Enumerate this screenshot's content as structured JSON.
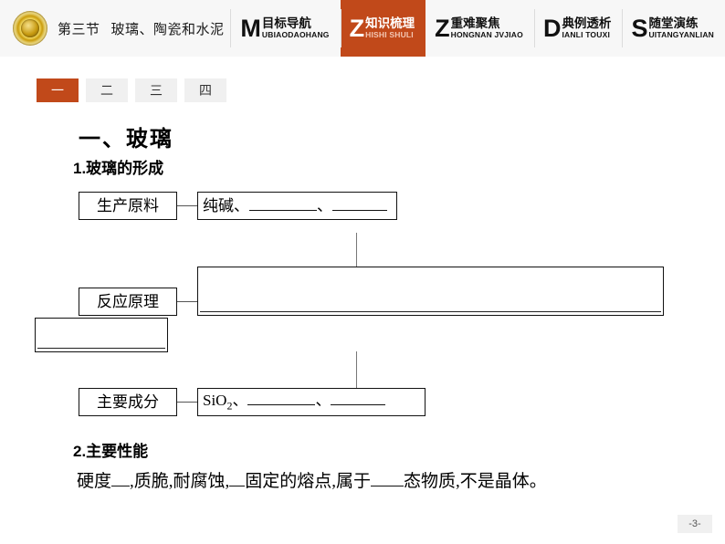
{
  "header": {
    "logo_icon": "gold-medallion-icon",
    "section_label": "第三节",
    "section_title": "玻璃、陶瓷和水泥",
    "accent_color": "#c1491a",
    "tabs": [
      {
        "letter": "M",
        "cn": "目标导航",
        "py": "UBIAODAOHANG",
        "active": false
      },
      {
        "letter": "Z",
        "cn": "知识梳理",
        "py": "HISHI SHULI",
        "active": true
      },
      {
        "letter": "Z",
        "cn": "重难聚焦",
        "py": "HONGNAN JVJIAO",
        "active": false
      },
      {
        "letter": "D",
        "cn": "典例透析",
        "py": "IANLI TOUXI",
        "active": false
      },
      {
        "letter": "S",
        "cn": "随堂演练",
        "py": "UITANGYANLIAN",
        "active": false
      }
    ]
  },
  "subtabs": [
    {
      "label": "一",
      "active": true
    },
    {
      "label": "二",
      "active": false
    },
    {
      "label": "三",
      "active": false
    },
    {
      "label": "四",
      "active": false
    }
  ],
  "content": {
    "heading_main": "一、玻璃",
    "heading_1": "1.玻璃的形成",
    "heading_2": "2.主要性能",
    "flow": {
      "raw_material_label": "生产原料",
      "raw_material_value_prefix": "纯碱、",
      "raw_material_value_mid": "、",
      "principle_label": "反应原理",
      "principle_value": "",
      "principle_value_2": "",
      "composition_label": "主要成分",
      "composition_value_prefix": "SiO",
      "composition_value_sub": "2",
      "composition_value_after": "、",
      "composition_value_mid": "、"
    },
    "performance": {
      "part1": "硬度",
      "part2": ",质脆,耐腐蚀,",
      "part3": "固定的熔点,属于",
      "part4": "态物质,不是晶体。"
    }
  },
  "footer": {
    "page_number": "-3-"
  }
}
